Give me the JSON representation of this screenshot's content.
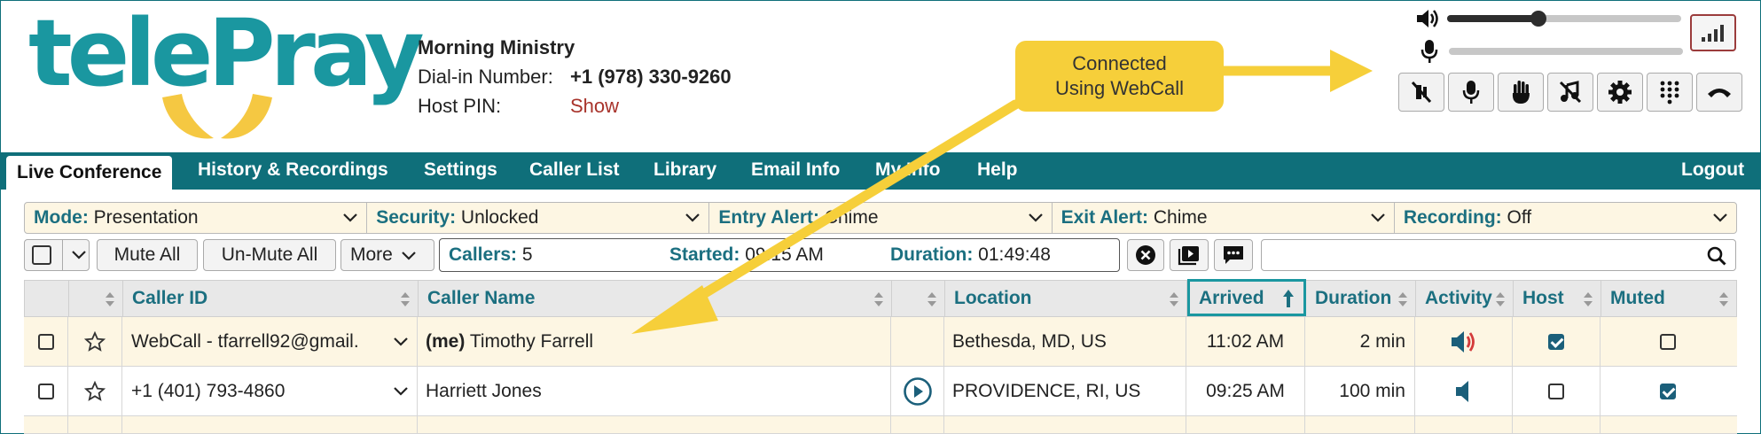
{
  "brand": {
    "logo_text": "telePray"
  },
  "conference": {
    "name": "Morning Ministry",
    "dialin_label": "Dial-in Number:",
    "dialin_value": "+1 (978) 330-9260",
    "pin_label": "Host PIN:",
    "pin_link": "Show"
  },
  "callout": {
    "line1": "Connected",
    "line2": "Using WebCall"
  },
  "audio": {
    "speaker_level": 0.39,
    "mic_level": 0.0
  },
  "nav": {
    "items": [
      "Live Conference",
      "History & Recordings",
      "Settings",
      "Caller List",
      "Library",
      "Email Info",
      "My Info",
      "Help"
    ],
    "logout": "Logout"
  },
  "settings": {
    "mode_label": "Mode:",
    "mode_value": "Presentation",
    "security_label": "Security:",
    "security_value": "Unlocked",
    "entry_label": "Entry Alert:",
    "entry_value": "Chime",
    "exit_label": "Exit Alert:",
    "exit_value": "Chime",
    "recording_label": "Recording:",
    "recording_value": "Off"
  },
  "controls": {
    "mute_all": "Mute All",
    "unmute_all": "Un-Mute All",
    "more": "More",
    "callers_label": "Callers:",
    "callers_value": "5",
    "started_label": "Started:",
    "started_value": "09:15 AM",
    "duration_label": "Duration:",
    "duration_value": "01:49:48",
    "search_value": ""
  },
  "table": {
    "headers": {
      "caller_id": "Caller ID",
      "caller_name": "Caller Name",
      "location": "Location",
      "arrived": "Arrived",
      "duration": "Duration",
      "activity": "Activity",
      "host": "Host",
      "muted": "Muted"
    },
    "rows": [
      {
        "caller_id": "WebCall - tfarrell92@gmail.",
        "me": "(me)",
        "caller_name": "Timothy Farrell",
        "location": "Bethesda, MD, US",
        "arrived": "11:02 AM",
        "duration": "2 min",
        "activity": "speaking",
        "host": true,
        "muted": false,
        "has_play": false
      },
      {
        "caller_id": "+1 (401) 793-4860",
        "me": "",
        "caller_name": "Harriett Jones",
        "location": "PROVIDENCE, RI, US",
        "arrived": "09:25 AM",
        "duration": "100 min",
        "activity": "idle",
        "host": false,
        "muted": true,
        "has_play": true
      }
    ]
  },
  "colors": {
    "teal": "#0f6f7a",
    "accent": "#1a97a0",
    "callout": "#f6cf3a",
    "row_alt": "#fdf6e3"
  }
}
